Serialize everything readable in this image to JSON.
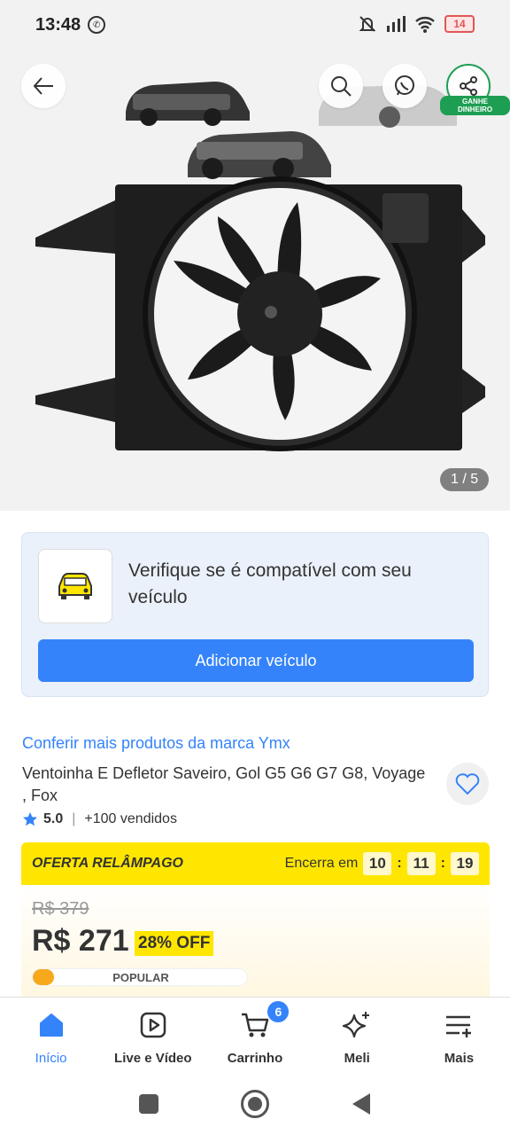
{
  "status_bar": {
    "time": "13:48",
    "battery": "14"
  },
  "gallery": {
    "page_indicator": "1 / 5",
    "earn_badge": "GANHE DINHEIRO"
  },
  "compat": {
    "title": "Verifique se é compatível com seu veículo",
    "button": "Adicionar veículo"
  },
  "product": {
    "brand_link": "Conferir mais produtos da marca Ymx",
    "title": "Ventoinha E Defletor Saveiro, Gol G5 G6 G7 G8, Voyage , Fox",
    "rating": "5.0",
    "sold": "+100 vendidos"
  },
  "flash": {
    "label": "OFERTA RELÂMPAGO",
    "ends_label": "Encerra em",
    "hours": "10",
    "minutes": "11",
    "seconds": "19"
  },
  "price": {
    "old": "R$ 379",
    "current": "R$ 271",
    "discount": "28% OFF",
    "popular_label": "POPULAR",
    "popular_fraction": 0.1
  },
  "nav": {
    "items": [
      {
        "label": "Início"
      },
      {
        "label": "Live e Vídeo"
      },
      {
        "label": "Carrinho"
      },
      {
        "label": "Meli"
      },
      {
        "label": "Mais"
      }
    ],
    "cart_count": "6"
  },
  "colors": {
    "accent": "#3483fa",
    "flash": "#ffe600",
    "share_green": "#1e9e52"
  }
}
